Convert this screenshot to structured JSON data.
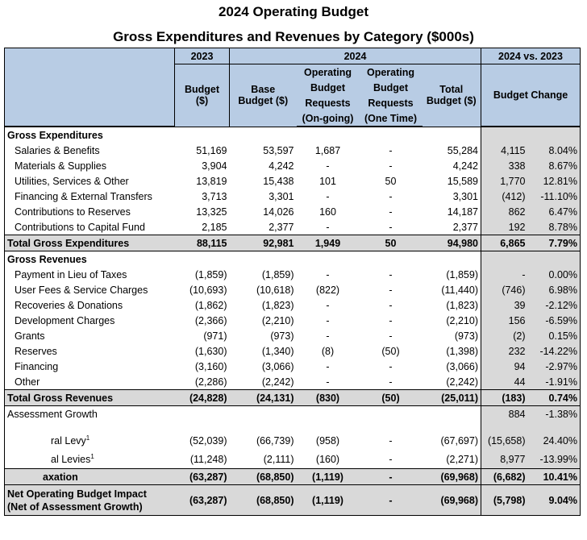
{
  "title": "2024 Operating Budget",
  "subtitle": "Gross Expenditures and Revenues by Category ($000s)",
  "header": {
    "y2023": "2023",
    "y2024": "2024",
    "vs": "2024 vs. 2023",
    "budget": "Budget",
    "budget_unit": "($)",
    "base": "Base",
    "base_unit": "Budget ($)",
    "opreq": "Operating",
    "opreq2": "Budget",
    "opreq3": "Requests",
    "ongoing": "(On-going)",
    "onetime": "(One Time)",
    "total": "Total",
    "total_unit": "Budget ($)",
    "change": "Budget Change"
  },
  "sections": {
    "gross_exp": "Gross Expenditures",
    "gross_rev": "Gross Revenues"
  },
  "expenditures": [
    {
      "label": "Salaries & Benefits",
      "b2023": "51,169",
      "base": "53,597",
      "ongoing": "1,687",
      "onetime": "-",
      "total": "55,284",
      "chg": "4,115",
      "pct": "8.04%"
    },
    {
      "label": "Materials & Supplies",
      "b2023": "3,904",
      "base": "4,242",
      "ongoing": "-",
      "onetime": "-",
      "total": "4,242",
      "chg": "338",
      "pct": "8.67%"
    },
    {
      "label": "Utilities, Services & Other",
      "b2023": "13,819",
      "base": "15,438",
      "ongoing": "101",
      "onetime": "50",
      "total": "15,589",
      "chg": "1,770",
      "pct": "12.81%"
    },
    {
      "label": "Financing & External Transfers",
      "b2023": "3,713",
      "base": "3,301",
      "ongoing": "-",
      "onetime": "-",
      "total": "3,301",
      "chg": "(412)",
      "pct": "-11.10%"
    },
    {
      "label": "Contributions to Reserves",
      "b2023": "13,325",
      "base": "14,026",
      "ongoing": "160",
      "onetime": "-",
      "total": "14,187",
      "chg": "862",
      "pct": "6.47%"
    },
    {
      "label": "Contributions to Capital Fund",
      "b2023": "2,185",
      "base": "2,377",
      "ongoing": "-",
      "onetime": "-",
      "total": "2,377",
      "chg": "192",
      "pct": "8.78%"
    }
  ],
  "total_exp": {
    "label": "Total Gross Expenditures",
    "b2023": "88,115",
    "base": "92,981",
    "ongoing": "1,949",
    "onetime": "50",
    "total": "94,980",
    "chg": "6,865",
    "pct": "7.79%"
  },
  "revenues": [
    {
      "label": "Payment in Lieu of Taxes",
      "b2023": "(1,859)",
      "base": "(1,859)",
      "ongoing": "-",
      "onetime": "-",
      "total": "(1,859)",
      "chg": "-",
      "pct": "0.00%"
    },
    {
      "label": "User Fees & Service Charges",
      "b2023": "(10,693)",
      "base": "(10,618)",
      "ongoing": "(822)",
      "onetime": "-",
      "total": "(11,440)",
      "chg": "(746)",
      "pct": "6.98%"
    },
    {
      "label": "Recoveries & Donations",
      "b2023": "(1,862)",
      "base": "(1,823)",
      "ongoing": "-",
      "onetime": "-",
      "total": "(1,823)",
      "chg": "39",
      "pct": "-2.12%"
    },
    {
      "label": "Development Charges",
      "b2023": "(2,366)",
      "base": "(2,210)",
      "ongoing": "-",
      "onetime": "-",
      "total": "(2,210)",
      "chg": "156",
      "pct": "-6.59%"
    },
    {
      "label": "Grants",
      "b2023": "(971)",
      "base": "(973)",
      "ongoing": "-",
      "onetime": "-",
      "total": "(973)",
      "chg": "(2)",
      "pct": "0.15%"
    },
    {
      "label": "Reserves",
      "b2023": "(1,630)",
      "base": "(1,340)",
      "ongoing": "(8)",
      "onetime": "(50)",
      "total": "(1,398)",
      "chg": "232",
      "pct": "-14.22%"
    },
    {
      "label": "Financing",
      "b2023": "(3,160)",
      "base": "(3,066)",
      "ongoing": "-",
      "onetime": "-",
      "total": "(3,066)",
      "chg": "94",
      "pct": "-2.97%"
    },
    {
      "label": "Other",
      "b2023": "(2,286)",
      "base": "(2,242)",
      "ongoing": "-",
      "onetime": "-",
      "total": "(2,242)",
      "chg": "44",
      "pct": "-1.91%"
    }
  ],
  "total_rev": {
    "label": "Total Gross Revenues",
    "b2023": "(24,828)",
    "base": "(24,131)",
    "ongoing": "(830)",
    "onetime": "(50)",
    "total": "(25,011)",
    "chg": "(183)",
    "pct": "0.74%"
  },
  "assessment": {
    "label": "Assessment Growth",
    "chg": "884",
    "pct": "-1.38%"
  },
  "levy": [
    {
      "label": "ral Levy",
      "sup": "1",
      "b2023": "(52,039)",
      "base": "(66,739)",
      "ongoing": "(958)",
      "onetime": "-",
      "total": "(67,697)",
      "chg": "(15,658)",
      "pct": "24.40%"
    },
    {
      "label": "al Levies",
      "sup": "1",
      "b2023": "(11,248)",
      "base": "(2,111)",
      "ongoing": "(160)",
      "onetime": "-",
      "total": "(2,271)",
      "chg": "8,977",
      "pct": "-13.99%"
    }
  ],
  "taxation": {
    "label": "axation",
    "b2023": "(63,287)",
    "base": "(68,850)",
    "ongoing": "(1,119)",
    "onetime": "-",
    "total": "(69,968)",
    "chg": "(6,682)",
    "pct": "10.41%"
  },
  "net": {
    "label1": "Net Operating Budget Impact",
    "label2": "(Net of Assessment Growth)",
    "b2023": "(63,287)",
    "base": "(68,850)",
    "ongoing": "(1,119)",
    "onetime": "-",
    "total": "(69,968)",
    "chg": "(5,798)",
    "pct": "9.04%"
  }
}
